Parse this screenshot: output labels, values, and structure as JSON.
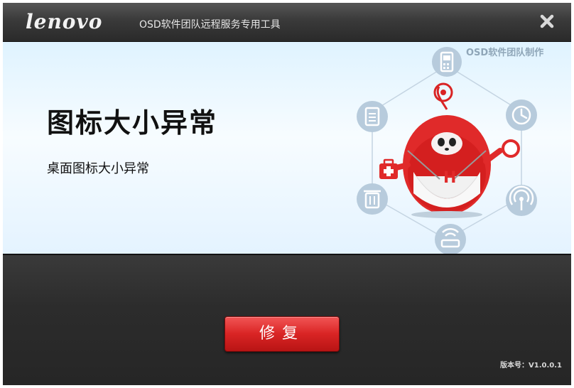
{
  "titlebar": {
    "logo_text": "lenovo",
    "subtitle": "OSD软件团队远程服务专用工具",
    "close_icon": "close-icon"
  },
  "banner": {
    "heading": "图标大小异常",
    "description": "桌面图标大小异常",
    "credit": "OSD软件团队制作",
    "mascot_letter": "H",
    "icons": [
      "phone-icon",
      "clock-icon",
      "wifi-icon",
      "router-icon",
      "trash-icon",
      "clipboard-icon",
      "first-aid-icon",
      "magnifier-icon"
    ]
  },
  "footer": {
    "repair_label": "修复",
    "version": "版本号：V1.0.0.1"
  },
  "colors": {
    "accent_red": "#e02a2a",
    "icon_blue": "#b9cfe0",
    "titlebar": "#3a3a3a"
  }
}
